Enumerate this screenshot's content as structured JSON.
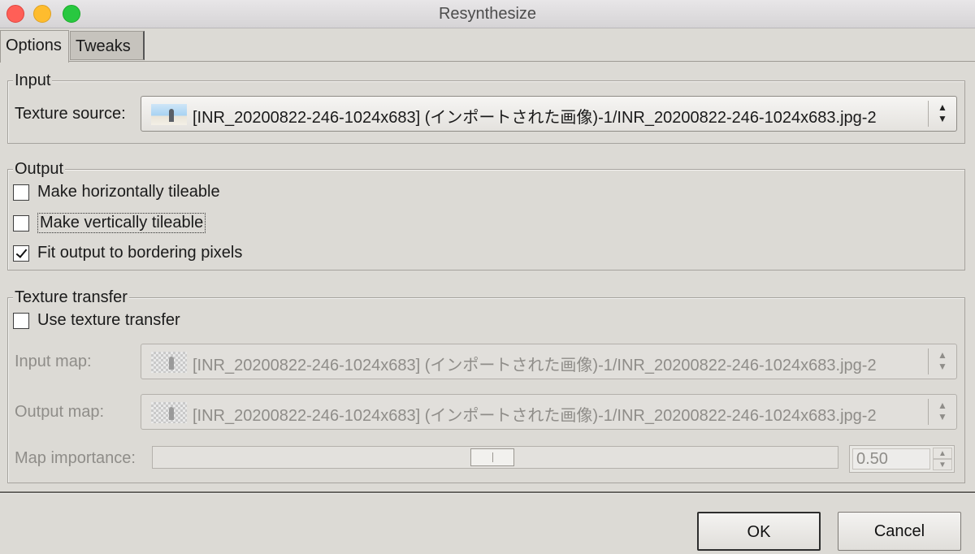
{
  "window": {
    "title": "Resynthesize"
  },
  "tabs": [
    {
      "label": "Options"
    },
    {
      "label": "Tweaks"
    }
  ],
  "input_section": {
    "legend": "Input",
    "texture_source_label": "Texture source:",
    "texture_source_value": "[INR_20200822-246-1024x683] (インポートされた画像)-1/INR_20200822-246-1024x683.jpg-2"
  },
  "output_section": {
    "legend": "Output",
    "options": [
      {
        "label": "Make horizontally tileable",
        "checked": false
      },
      {
        "label": "Make vertically tileable",
        "checked": false
      },
      {
        "label": "Fit output to bordering pixels",
        "checked": true
      }
    ]
  },
  "transfer_section": {
    "legend": "Texture transfer",
    "use_label": "Use texture transfer",
    "input_map_label": "Input map:",
    "input_map_value": "[INR_20200822-246-1024x683] (インポートされた画像)-1/INR_20200822-246-1024x683.jpg-2",
    "output_map_label": "Output map:",
    "output_map_value": "[INR_20200822-246-1024x683] (インポートされた画像)-1/INR_20200822-246-1024x683.jpg-2",
    "map_importance_label": "Map importance:",
    "map_importance_value": "0.50"
  },
  "buttons": {
    "ok": "OK",
    "cancel": "Cancel"
  }
}
